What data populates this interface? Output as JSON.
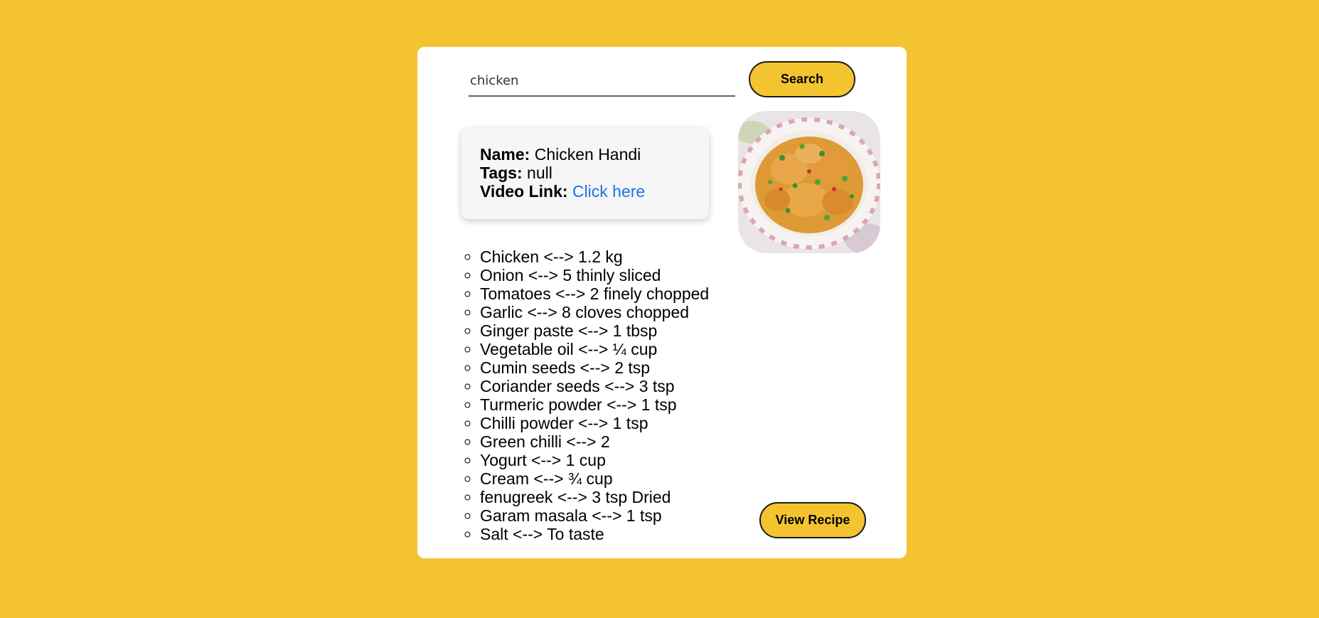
{
  "search": {
    "value": "chicken",
    "button_label": "Search"
  },
  "recipe": {
    "name_label": "Name:",
    "name": "Chicken Handi",
    "tags_label": "Tags:",
    "tags": "null",
    "video_label": "Video Link:",
    "video_link_text": "Click here",
    "image_alt": "Chicken Handi dish"
  },
  "ingredients": [
    "Chicken <--> 1.2 kg",
    "Onion <--> 5 thinly sliced",
    "Tomatoes <--> 2 finely chopped",
    "Garlic <--> 8 cloves chopped",
    "Ginger paste <--> 1 tbsp",
    "Vegetable oil <--> ¼ cup",
    "Cumin seeds <--> 2 tsp",
    "Coriander seeds <--> 3 tsp",
    "Turmeric powder <--> 1 tsp",
    "Chilli powder <--> 1 tsp",
    "Green chilli <--> 2",
    "Yogurt <--> 1 cup",
    "Cream <--> ¾ cup",
    "fenugreek <--> 3 tsp Dried",
    "Garam masala <--> 1 tsp",
    "Salt <--> To taste"
  ],
  "actions": {
    "view_recipe_label": "View Recipe"
  },
  "colors": {
    "background": "#f4c430",
    "card": "#ffffff",
    "button": "#f4c430",
    "link": "#1a73e8"
  }
}
